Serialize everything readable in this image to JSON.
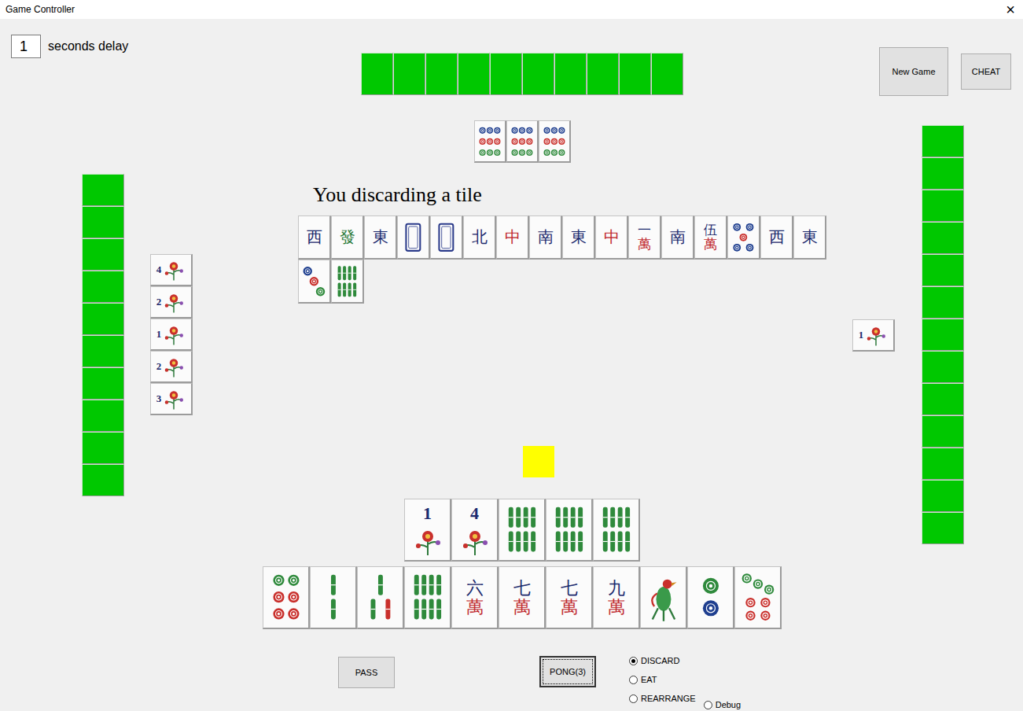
{
  "window": {
    "title": "Game Controller",
    "close": "×"
  },
  "delay": {
    "value": "1",
    "label": "seconds delay"
  },
  "top_buttons": [
    {
      "label": "New Game"
    },
    {
      "label": "CHEAT"
    }
  ],
  "message": "You discarding a tile",
  "turn_marker": {
    "color": "#ffff00"
  },
  "opponents": {
    "top": {
      "concealed": 10,
      "melds": [
        {
          "kind": "dots",
          "count": 9
        },
        {
          "kind": "dots",
          "count": 9
        },
        {
          "kind": "dots",
          "count": 9
        }
      ]
    },
    "left": {
      "concealed": 10,
      "melds": [
        {
          "kind": "flower",
          "number": "4"
        },
        {
          "kind": "flower",
          "number": "2"
        },
        {
          "kind": "flower",
          "number": "1"
        },
        {
          "kind": "flower",
          "number": "2"
        },
        {
          "kind": "flower",
          "number": "3"
        }
      ]
    },
    "right": {
      "concealed": 13,
      "melds": [
        {
          "kind": "flower",
          "number": "1"
        }
      ]
    }
  },
  "discards": [
    {
      "kind": "honor",
      "text": "西",
      "color": "#1c2a6e"
    },
    {
      "kind": "honor",
      "text": "發",
      "color": "#2a7a3a"
    },
    {
      "kind": "honor",
      "text": "東",
      "color": "#1c2a6e"
    },
    {
      "kind": "blank"
    },
    {
      "kind": "blank"
    },
    {
      "kind": "honor",
      "text": "北",
      "color": "#1c2a6e"
    },
    {
      "kind": "honor",
      "text": "中",
      "color": "#c0282d"
    },
    {
      "kind": "honor",
      "text": "南",
      "color": "#1c2a6e"
    },
    {
      "kind": "honor",
      "text": "東",
      "color": "#1c2a6e"
    },
    {
      "kind": "honor",
      "text": "中",
      "color": "#c0282d"
    },
    {
      "kind": "character",
      "rank": "一",
      "suit": "萬"
    },
    {
      "kind": "honor",
      "text": "南",
      "color": "#1c2a6e"
    },
    {
      "kind": "character",
      "rank": "伍",
      "suit": "萬"
    },
    {
      "kind": "dots",
      "count": 5
    },
    {
      "kind": "honor",
      "text": "西",
      "color": "#1c2a6e"
    },
    {
      "kind": "honor",
      "text": "東",
      "color": "#1c2a6e"
    },
    {
      "kind": "dots",
      "count": 3
    },
    {
      "kind": "bamboo",
      "count": 8
    }
  ],
  "player": {
    "melds": [
      {
        "kind": "flower",
        "number": "1"
      },
      {
        "kind": "flower",
        "number": "4"
      },
      {
        "kind": "bamboo",
        "count": 8
      },
      {
        "kind": "bamboo",
        "count": 8
      },
      {
        "kind": "bamboo",
        "count": 8
      }
    ],
    "hand": [
      {
        "kind": "dots",
        "count": 6
      },
      {
        "kind": "bamboo",
        "count": 2
      },
      {
        "kind": "bamboo",
        "count": 3
      },
      {
        "kind": "bamboo",
        "count": 8
      },
      {
        "kind": "character",
        "rank": "六",
        "suit": "萬"
      },
      {
        "kind": "character",
        "rank": "七",
        "suit": "萬"
      },
      {
        "kind": "character",
        "rank": "七",
        "suit": "萬"
      },
      {
        "kind": "character",
        "rank": "九",
        "suit": "萬"
      },
      {
        "kind": "bamboo",
        "count": 1
      },
      {
        "kind": "dots",
        "count": 2
      },
      {
        "kind": "dots",
        "count": 7
      }
    ]
  },
  "action_buttons": [
    {
      "label": "PASS",
      "focused": false
    },
    {
      "label": "PONG(3)",
      "focused": true
    }
  ],
  "modes": [
    {
      "label": "DISCARD",
      "selected": true
    },
    {
      "label": "EAT",
      "selected": false
    },
    {
      "label": "REARRANGE",
      "selected": false
    },
    {
      "label": "Debug",
      "selected": false
    }
  ]
}
